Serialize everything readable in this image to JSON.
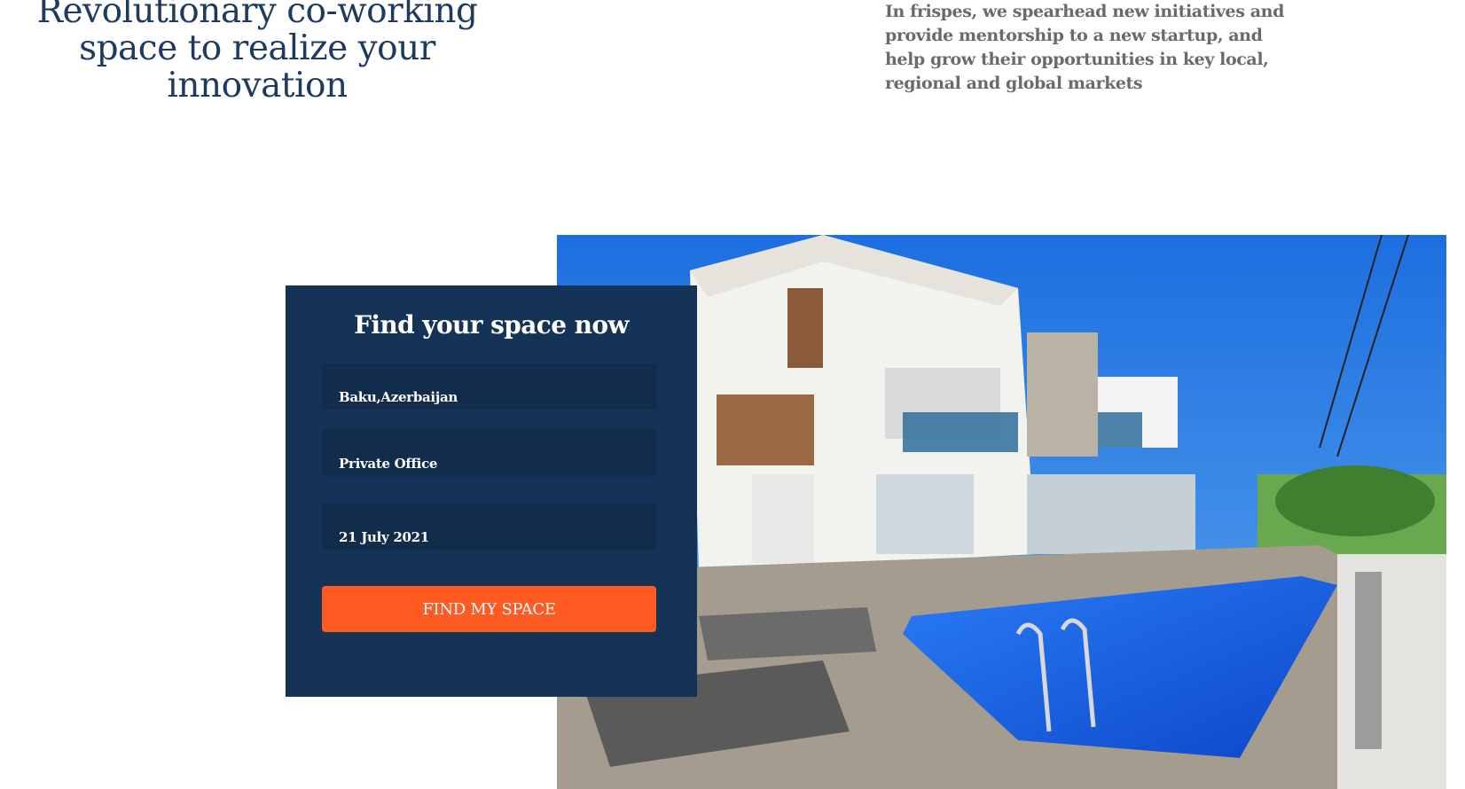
{
  "hero": {
    "title": "Revolutionary co-working space to realize your innovation",
    "description": "In frispes, we spearhead new initiatives and provide mentorship to a new startup, and help grow their opportunities in key local, regional and global markets"
  },
  "search": {
    "title": "Find your space now",
    "location_value": "Baku,Azerbaijan",
    "office_type_value": "Private Office",
    "date_value": "21 July 2021",
    "button_label": "FIND MY SPACE"
  },
  "colors": {
    "heading": "#1f3a5f",
    "card_background": "#153356",
    "field_background": "#122c4c",
    "button": "#ff5a22"
  }
}
